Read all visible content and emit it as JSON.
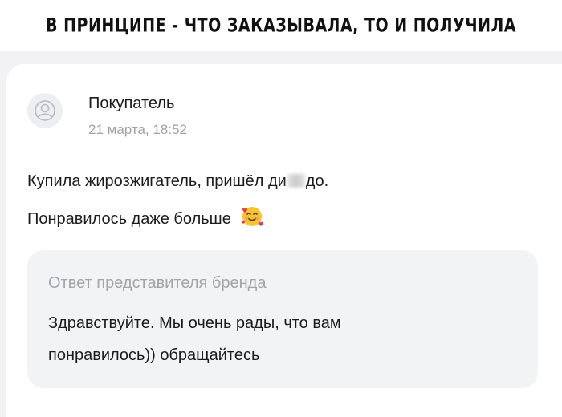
{
  "caption": "В ПРИНЦИПЕ - ЧТО ЗАКАЗЫВАЛА, ТО И ПОЛУЧИЛА",
  "review": {
    "author": "Покупатель",
    "date": "21 марта, 18:52",
    "text_line1_before": "Купила жирозжигатель, пришёл ди",
    "text_line1_after": "до.",
    "text_line2": "Понравилось даже больше",
    "avatar_icon": "user-avatar-icon",
    "emoji_icon": "smiling-face-with-hearts-emoji"
  },
  "brand_reply": {
    "title": "Ответ представителя бренда",
    "line1": "Здравствуйте. Мы очень рады, что вам",
    "line2": "понравилось)) обращайтесь"
  },
  "colors": {
    "page_bg": "#f2f2f4",
    "card_bg": "#ffffff",
    "reply_bg": "#f2f3f5",
    "muted_text": "#a0a0a6",
    "text": "#1c1c1e"
  }
}
